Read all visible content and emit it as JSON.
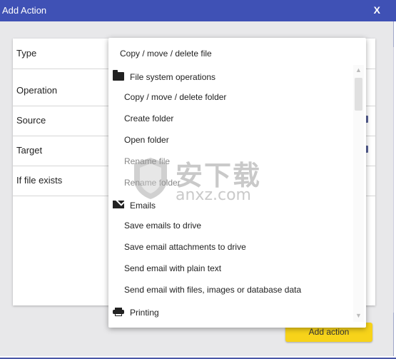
{
  "window": {
    "title": "Add Action",
    "close_label": "X"
  },
  "form": {
    "rows": [
      {
        "label": "Type"
      },
      {
        "label": "Operation"
      },
      {
        "label": "Source"
      },
      {
        "label": "Target"
      },
      {
        "label": "If file exists"
      }
    ]
  },
  "dropdown": {
    "selected": "Copy / move / delete file",
    "groups": [
      {
        "icon": "folder-icon",
        "label": "File system operations"
      },
      {
        "icon": "email-icon",
        "label": "Emails"
      },
      {
        "icon": "printer-icon",
        "label": "Printing"
      }
    ],
    "options": [
      "Copy / move / delete folder",
      "Create folder",
      "Open folder",
      "Rename file",
      "Rename folder",
      "Save emails to drive",
      "Save email attachments to drive",
      "Send email with plain text",
      "Send email with files, images or database data"
    ]
  },
  "add_button": "Add action",
  "watermark": {
    "cn": "安下载",
    "en": "anxz.com"
  },
  "colors": {
    "titlebar": "#3f51b5",
    "accent_button": "#f7d31a",
    "dialog_bg": "#e8e8ea"
  }
}
